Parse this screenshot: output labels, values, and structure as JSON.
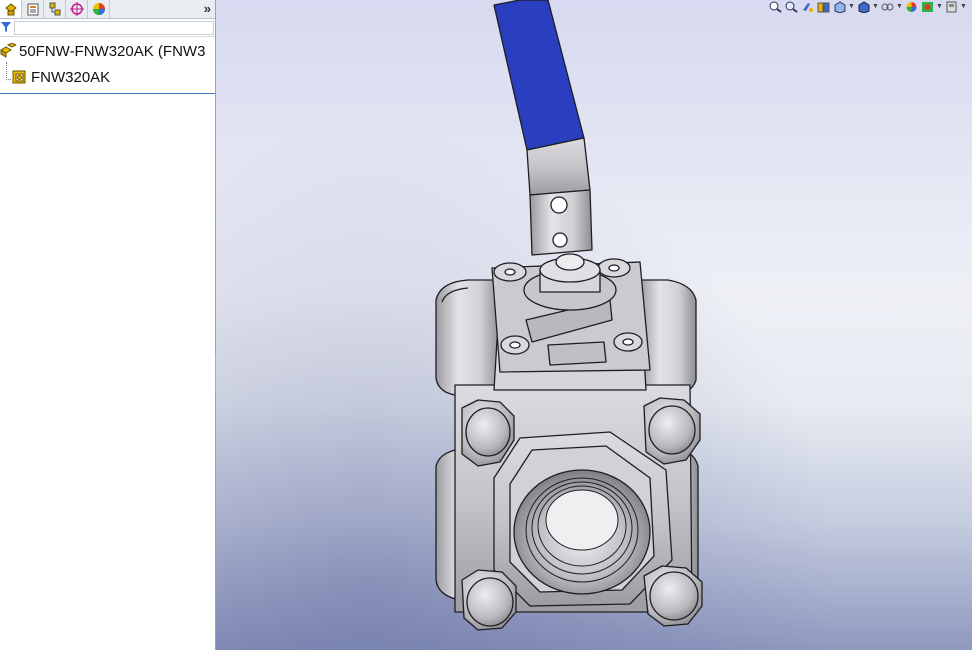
{
  "feature_tree": {
    "root_label": "50FNW-FNW320AK  (FNW3",
    "part_label": "FNW320AK"
  },
  "panel_tabs": [
    "featuremanager-icon",
    "propertymanager-icon",
    "configurationmanager-icon",
    "dimxpert-icon",
    "display-manager-icon"
  ],
  "panel_more": "»",
  "view_toolbar": [
    "zoom-to-fit-icon",
    "zoom-area-icon",
    "previous-view-icon",
    "section-view-icon",
    "view-orientation-icon",
    "display-style-icon",
    "hide-show-icon",
    "edit-appearance-icon",
    "apply-scene-icon",
    "view-settings-icon"
  ],
  "colors": {
    "handle_grip": "#2a3fc0",
    "metal": "#c8c8cc",
    "panel_accent": "#3a7fc4"
  }
}
